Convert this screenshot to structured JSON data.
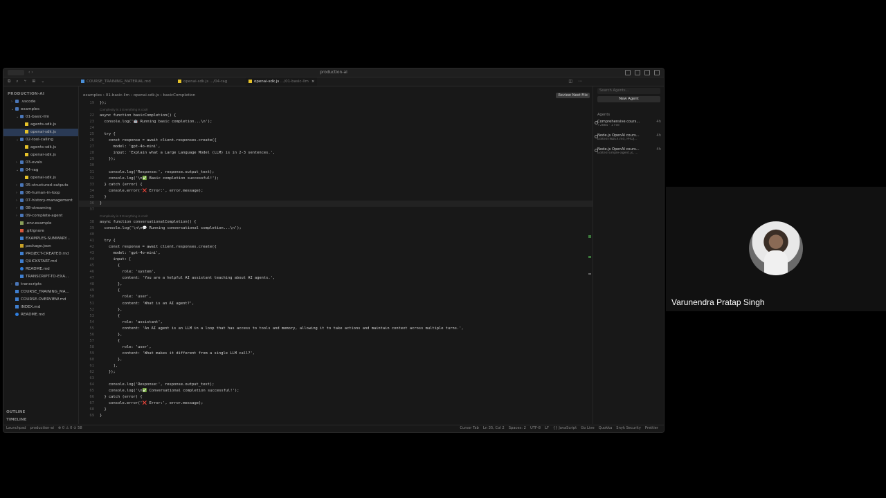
{
  "window": {
    "title": "production-ai"
  },
  "participant": {
    "name": "Varunendra Pratap Singh"
  },
  "tabs": [
    {
      "label": "COURSE_TRAINING_MATERIAL.md",
      "kind": "md",
      "active": false
    },
    {
      "label": "openai-sdk.js",
      "path": ".../04-rag",
      "kind": "js",
      "active": false
    },
    {
      "label": "openai-sdk.js",
      "path": ".../01-basic-llm",
      "kind": "js",
      "active": true
    }
  ],
  "breadcrumb": [
    "examples",
    "01-basic-llm",
    "openai-sdk.js",
    "basicCompletion"
  ],
  "review_button": "Review Next File",
  "sidebar": {
    "root": "PRODUCTION-AI",
    "items": [
      {
        "label": ".vscode",
        "type": "folder",
        "depth": 1,
        "open": false
      },
      {
        "label": "examples",
        "type": "folder",
        "depth": 1,
        "open": true
      },
      {
        "label": "01-basic-llm",
        "type": "folder",
        "depth": 2,
        "open": true
      },
      {
        "label": "agents-sdk.js",
        "type": "js",
        "depth": 3
      },
      {
        "label": "openai-sdk.js",
        "type": "js",
        "depth": 3,
        "selected": true
      },
      {
        "label": "02-tool-calling",
        "type": "folder",
        "depth": 2,
        "open": true
      },
      {
        "label": "agents-sdk.js",
        "type": "js",
        "depth": 3
      },
      {
        "label": "openai-sdk.js",
        "type": "js",
        "depth": 3
      },
      {
        "label": "03-evals",
        "type": "folder",
        "depth": 2,
        "open": false
      },
      {
        "label": "04-rag",
        "type": "folder",
        "depth": 2,
        "open": true
      },
      {
        "label": "openai-sdk.js",
        "type": "js",
        "depth": 3
      },
      {
        "label": "05-structured-outputs",
        "type": "folder",
        "depth": 2,
        "open": false
      },
      {
        "label": "06-human-in-loop",
        "type": "folder",
        "depth": 2,
        "open": false
      },
      {
        "label": "07-history-management",
        "type": "folder",
        "depth": 2,
        "open": false
      },
      {
        "label": "08-streaming",
        "type": "folder",
        "depth": 2,
        "open": false
      },
      {
        "label": "09-complete-agent",
        "type": "folder",
        "depth": 2,
        "open": false
      },
      {
        "label": ".env.example",
        "type": "env",
        "depth": 2
      },
      {
        "label": ".gitignore",
        "type": "git",
        "depth": 2
      },
      {
        "label": "EXAMPLES-SUMMARY...",
        "type": "md",
        "depth": 2
      },
      {
        "label": "package.json",
        "type": "json",
        "depth": 2
      },
      {
        "label": "PROJECT-CREATED.md",
        "type": "md",
        "depth": 2
      },
      {
        "label": "QUICKSTART.md",
        "type": "md",
        "depth": 2
      },
      {
        "label": "README.md",
        "type": "info",
        "depth": 2
      },
      {
        "label": "TRANSCRIPT-TO-EXA...",
        "type": "md",
        "depth": 2
      },
      {
        "label": "transcripts",
        "type": "folder",
        "depth": 1,
        "open": false
      },
      {
        "label": "COURSE_TRAINING_MA...",
        "type": "md",
        "depth": 1
      },
      {
        "label": "COURSE-OVERVIEW.md",
        "type": "md",
        "depth": 1
      },
      {
        "label": "INDEX.md",
        "type": "md",
        "depth": 1
      },
      {
        "label": "README.md",
        "type": "info",
        "depth": 1
      }
    ],
    "outline": "OUTLINE",
    "timeline": "TIMELINE"
  },
  "code_lines": [
    {
      "n": "19",
      "t": "});"
    },
    {
      "n": "",
      "t": "Complexity is 3 Everything is cool!",
      "lens": true
    },
    {
      "n": "22",
      "t": "async function basicCompletion() {"
    },
    {
      "n": "23",
      "t": "  console.log('🤖 Running basic completion...\\n');"
    },
    {
      "n": "24",
      "t": ""
    },
    {
      "n": "25",
      "t": "  try {"
    },
    {
      "n": "26",
      "t": "    const response = await client.responses.create({"
    },
    {
      "n": "27",
      "t": "      model: 'gpt-4o-mini',"
    },
    {
      "n": "28",
      "t": "      input: 'Explain what a Large Language Model (LLM) is in 2-3 sentences.',"
    },
    {
      "n": "29",
      "t": "    });"
    },
    {
      "n": "30",
      "t": ""
    },
    {
      "n": "31",
      "t": "    console.log('Response:', response.output_text);"
    },
    {
      "n": "32",
      "t": "    console.log('\\n✅ Basic completion successful!');"
    },
    {
      "n": "33",
      "t": "  } catch (error) {"
    },
    {
      "n": "34",
      "t": "    console.error('❌ Error:', error.message);"
    },
    {
      "n": "35",
      "t": "  }"
    },
    {
      "n": "36",
      "t": "}",
      "current": true
    },
    {
      "n": "37",
      "t": ""
    },
    {
      "n": "",
      "t": "Complexity is 3 Everything is cool!",
      "lens": true
    },
    {
      "n": "38",
      "t": "async function conversationalCompletion() {"
    },
    {
      "n": "39",
      "t": "  console.log('\\n\\n💬 Running conversational completion...\\n');"
    },
    {
      "n": "40",
      "t": ""
    },
    {
      "n": "41",
      "t": "  try {"
    },
    {
      "n": "42",
      "t": "    const response = await client.responses.create({"
    },
    {
      "n": "43",
      "t": "      model: 'gpt-4o-mini',"
    },
    {
      "n": "44",
      "t": "      input: ["
    },
    {
      "n": "45",
      "t": "        {"
    },
    {
      "n": "46",
      "t": "          role: 'system',"
    },
    {
      "n": "47",
      "t": "          content: 'You are a helpful AI assistant teaching about AI agents.',"
    },
    {
      "n": "48",
      "t": "        },"
    },
    {
      "n": "49",
      "t": "        {"
    },
    {
      "n": "50",
      "t": "          role: 'user',"
    },
    {
      "n": "51",
      "t": "          content: 'What is an AI agent?',"
    },
    {
      "n": "52",
      "t": "        },"
    },
    {
      "n": "53",
      "t": "        {"
    },
    {
      "n": "54",
      "t": "          role: 'assistant',"
    },
    {
      "n": "55",
      "t": "          content: 'An AI agent is an LLM in a loop that has access to tools and memory, allowing it to take actions and maintain context across multiple turns.',"
    },
    {
      "n": "56",
      "t": "        },"
    },
    {
      "n": "57",
      "t": "        {"
    },
    {
      "n": "58",
      "t": "          role: 'user',"
    },
    {
      "n": "59",
      "t": "          content: 'What makes it different from a single LLM call?',"
    },
    {
      "n": "60",
      "t": "        },"
    },
    {
      "n": "61",
      "t": "      ],"
    },
    {
      "n": "62",
      "t": "    });"
    },
    {
      "n": "63",
      "t": ""
    },
    {
      "n": "64",
      "t": "    console.log('Response:', response.output_text);"
    },
    {
      "n": "65",
      "t": "    console.log('\\n✅ Conversational completion successful!');"
    },
    {
      "n": "66",
      "t": "  } catch (error) {"
    },
    {
      "n": "67",
      "t": "    console.error('❌ Error:', error.message);"
    },
    {
      "n": "68",
      "t": "  }"
    },
    {
      "n": "69",
      "t": "}"
    }
  ],
  "agents_panel": {
    "search_placeholder": "Search Agents...",
    "new_agent": "New Agent",
    "heading": "Agents",
    "items": [
      {
        "name": "Comprehensive cours...",
        "sub": "+2885 · 1 File",
        "time": "4h"
      },
      {
        "name": "Node.js OpenAI cours...",
        "sub": "Edited INDEX.md, PROJ...",
        "time": "4h"
      },
      {
        "name": "Node.js OpenAI cours...",
        "sub": "Edited simple-agent.js, ...",
        "time": "4h"
      }
    ]
  },
  "statusbar": {
    "left": [
      "Launchpad",
      "production-ai",
      "⊗ 0 ⚠ 0 ⊙ 58"
    ],
    "right": [
      "Cursor Tab",
      "Ln 35, Col 2",
      "Spaces: 2",
      "UTF-8",
      "LF",
      "{} JavaScript",
      "Go Live",
      "Quokka",
      "Snyk Security",
      "Prettier"
    ]
  }
}
